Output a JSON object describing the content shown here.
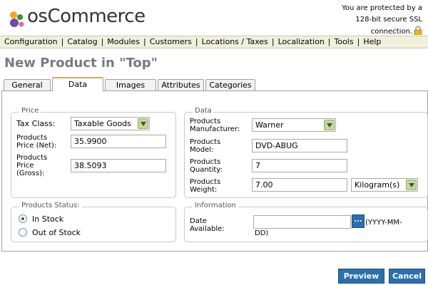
{
  "brand": {
    "logo_text": "osCommerce"
  },
  "ssl_notice": {
    "line1": "You are protected by a",
    "line2": "128-bit secure SSL",
    "line3": "connection."
  },
  "menu": [
    "Configuration",
    "Catalog",
    "Modules",
    "Customers",
    "Locations / Taxes",
    "Localization",
    "Tools",
    "Help"
  ],
  "page_title": "New Product in \"Top\"",
  "tabs": [
    "General",
    "Data",
    "Images",
    "Attributes",
    "Categories"
  ],
  "active_tab": "Data",
  "price": {
    "legend": "Price",
    "tax_class_label": "Tax Class:",
    "tax_class_value": "Taxable Goods",
    "net_label_1": "Products",
    "net_label_2": "Price (Net):",
    "net_value": "35.9900",
    "gross_label_1": "Products",
    "gross_label_2": "Price",
    "gross_label_3": "(Gross):",
    "gross_value": "38.5093"
  },
  "data": {
    "legend": "Data",
    "manufacturer_label_1": "Products",
    "manufacturer_label_2": "Manufacturer:",
    "manufacturer_value": "Warner",
    "model_label_1": "Products",
    "model_label_2": "Model:",
    "model_value": "DVD-ABUG",
    "quantity_label_1": "Products",
    "quantity_label_2": "Quantity:",
    "quantity_value": "7",
    "weight_label_1": "Products",
    "weight_label_2": "Weight:",
    "weight_value": "7.00",
    "weight_unit": "Kilogram(s)"
  },
  "status": {
    "legend": "Products Status:",
    "option_in": "In Stock",
    "option_out": "Out of Stock",
    "selected": "In Stock"
  },
  "information": {
    "legend": "Information",
    "date_label_1": "Date",
    "date_label_2": "Available:",
    "date_value": "",
    "date_button": "...",
    "date_format_1": "(YYYY-MM-",
    "date_format_2": "DD)"
  },
  "buttons": {
    "preview": "Preview",
    "cancel": "Cancel"
  },
  "colors": {
    "menu_bg": "#f0f1db",
    "title": "#7a7a7a",
    "button": "#2a6fae",
    "active_tab_accent": "#e9a33b"
  }
}
